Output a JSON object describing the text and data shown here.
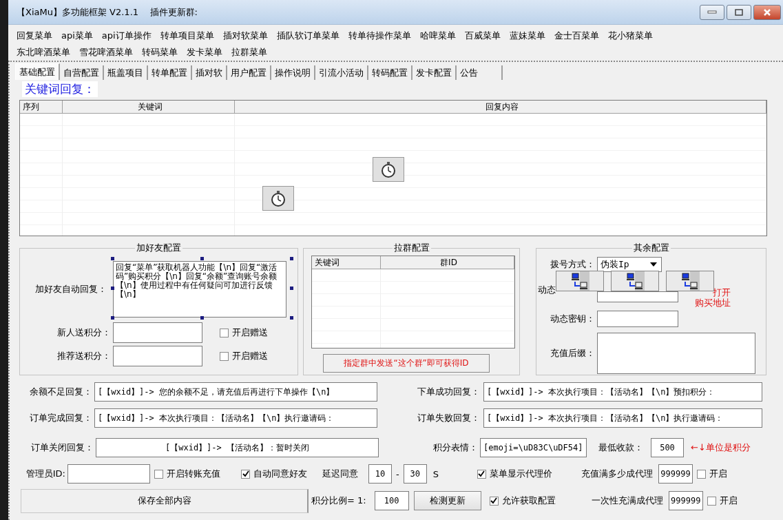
{
  "window": {
    "title": "【XiaMu】多功能框架 V2.1.1    插件更新群:"
  },
  "menu_rows": [
    [
      "回复菜单",
      "api菜单",
      "api订单操作",
      "转单项目菜单",
      "插对软菜单",
      "插队软订单菜单",
      "转单待操作菜单",
      "哈啤菜单",
      "百威菜单",
      "蓝妹菜单",
      "金士百菜单",
      "花小猪菜单"
    ],
    [
      "东北啤酒菜单",
      "雪花啤酒菜单",
      "转码菜单",
      "发卡菜单",
      "拉群菜单"
    ]
  ],
  "tabs": [
    {
      "label": "基础配置",
      "selected": true
    },
    {
      "label": "自营配置",
      "selected": false
    },
    {
      "label": "瓶盖项目",
      "selected": false
    },
    {
      "label": "转单配置",
      "selected": false
    },
    {
      "label": "插对软",
      "selected": false
    },
    {
      "label": "用户配置",
      "selected": false
    },
    {
      "label": "操作说明",
      "selected": false
    },
    {
      "label": "引流小活动",
      "selected": false
    },
    {
      "label": "转码配置",
      "selected": false
    },
    {
      "label": "发卡配置",
      "selected": false
    },
    {
      "label": "公告",
      "selected": false
    }
  ],
  "keyword_reply": {
    "heading": "关键词回复：",
    "columns": [
      "序列",
      "关键词",
      "回复内容"
    ]
  },
  "add_friend": {
    "title": "加好友配置",
    "auto_reply_label": "加好友自动回复：",
    "auto_reply": "回复“菜单”获取机器人功能【\\n】回复“激活码”购买积分【\\n】回复“余额”查询账号余额【\\n】使用过程中有任何疑问可加进行反馈【\\n】",
    "gifts": [
      {
        "label": "新人送积分：",
        "checkbox": "开启赠送",
        "checked": false
      },
      {
        "label": "推荐送积分：",
        "checkbox": "开启赠送",
        "checked": false
      }
    ]
  },
  "pull_group": {
    "title": "拉群配置",
    "columns": [
      "关键词",
      "群ID"
    ],
    "hint": "指定群中发送“这个群”即可获得ID"
  },
  "other": {
    "title": "其余配置",
    "dial_label": "拨号方式：",
    "dial_value": "伪装Ip",
    "dynamic_label": "动态",
    "link_lines": [
      "打开",
      "购买地址"
    ],
    "key_label": "动态密钥：",
    "suffix_label": "充值后缀："
  },
  "replies": [
    {
      "label": "余额不足回复：",
      "value": "[【wxid】]-> 您的余额不足，请充值后再进行下单操作【\\n】"
    },
    {
      "label": "下单成功回复：",
      "value": "[【wxid】]-> 本次执行项目：【活动名】【\\n】预扣积分："
    },
    {
      "label": "订单完成回复：",
      "value": "[【wxid】]-> 本次执行项目：【活动名】【\\n】执行邀请码："
    },
    {
      "label": "订单失败回复：",
      "value": "[【wxid】]-> 本次执行项目：【活动名】【\\n】执行邀请码："
    }
  ],
  "close_reply": {
    "label": "订单关闭回复：",
    "value": "[【wxid】]-> 【活动名】：暂时关闭"
  },
  "points_emoji": {
    "label": "积分表情：",
    "value": "[emoji=\\uD83C\\uDF54]"
  },
  "min_payment": {
    "label": "最低收款：",
    "value": "500",
    "note": "←↓单位是积分"
  },
  "admin": {
    "label": "管理员ID:"
  },
  "transfer": {
    "label": "开启转账充值",
    "checked": false
  },
  "auto_accept": {
    "label": "自动同意好友",
    "checked": true
  },
  "delay": {
    "label": "延迟同意",
    "from": "10",
    "dash": "-",
    "to": "30",
    "unit": "S"
  },
  "show_agent_price": {
    "label": "菜单显示代理价",
    "checked": true
  },
  "agent_threshold": {
    "label": "充值满多少成代理",
    "value": "999999",
    "checkbox": "开启",
    "checked": false
  },
  "save_button": "保存全部内容",
  "ratio": {
    "label": "积分比例= 1:",
    "value": "100"
  },
  "check_update": "检测更新",
  "allow_config": {
    "label": "允许获取配置",
    "checked": true
  },
  "one_time_agent": {
    "label": "一次性充满成代理",
    "value": "999999",
    "checkbox": "开启",
    "checked": false
  }
}
